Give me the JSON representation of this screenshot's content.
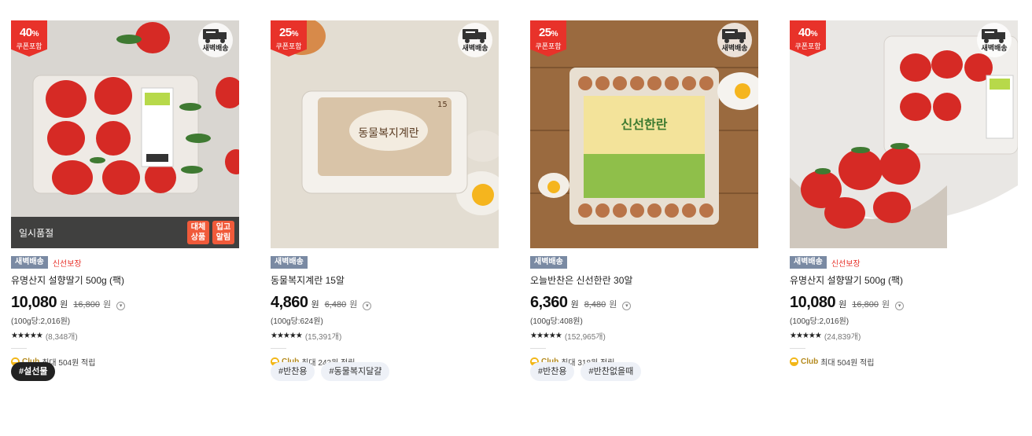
{
  "products": [
    {
      "discount": "40",
      "pct_sign": "%",
      "coupon": "쿠폰포함",
      "delivery_badge": "새벽배송",
      "soldout": {
        "label": "일시품절",
        "alt": "대체\n상품",
        "notify": "입고\n알림"
      },
      "tag_dawn": "새벽배송",
      "tag_fresh": "신선보장",
      "name": "유명산지 설향딸기 500g (팩)",
      "price": "10,080",
      "won": "원",
      "orig": "16,800",
      "orig_won": "원",
      "unit": "(100g당:2,016원)",
      "stars": "★★★★★",
      "reviews": "(8,348개)",
      "club_brand": "Club",
      "club_text": "최대 504원 적립",
      "tags": [
        "#설선물"
      ]
    },
    {
      "discount": "25",
      "pct_sign": "%",
      "coupon": "쿠폰포함",
      "delivery_badge": "새벽배송",
      "tag_dawn": "새벽배송",
      "tag_fresh": "",
      "name": "동물복지계란 15알",
      "price": "4,860",
      "won": "원",
      "orig": "6,480",
      "orig_won": "원",
      "unit": "(100g당:624원)",
      "stars": "★★★★★",
      "reviews": "(15,391개)",
      "club_brand": "Club",
      "club_text": "최대 243원 적립",
      "tags": [
        "#반찬용",
        "#동물복지달걀"
      ],
      "box_title": "동물복지계란",
      "box_count": "15"
    },
    {
      "discount": "25",
      "pct_sign": "%",
      "coupon": "쿠폰포함",
      "delivery_badge": "새벽배송",
      "tag_dawn": "새벽배송",
      "tag_fresh": "",
      "name": "오늘반찬은 신선한란 30알",
      "price": "6,360",
      "won": "원",
      "orig": "8,480",
      "orig_won": "원",
      "unit": "(100g당:408원)",
      "stars": "★★★★★",
      "reviews": "(152,965개)",
      "club_brand": "Club",
      "club_text": "최대 318원 적립",
      "tags": [
        "#반찬용",
        "#반찬없을때"
      ],
      "label_title": "신선한란"
    },
    {
      "discount": "40",
      "pct_sign": "%",
      "coupon": "쿠폰포함",
      "delivery_badge": "새벽배송",
      "tag_dawn": "새벽배송",
      "tag_fresh": "신선보장",
      "name": "유명산지 설향딸기 500g (팩)",
      "price": "10,080",
      "won": "원",
      "orig": "16,800",
      "orig_won": "원",
      "unit": "(100g당:2,016원)",
      "stars": "★★★★★",
      "reviews": "(24,839개)",
      "club_brand": "Club",
      "club_text": "최대 504원 적립",
      "tags": []
    }
  ],
  "colors": {
    "discount": "#e8322a",
    "dawn_badge": "#7a8aa3",
    "fresh": "#e8322a",
    "club": "#f2b617"
  },
  "icons": {
    "delivery": "truck-icon",
    "info": "info-icon",
    "club": "club-coin-icon"
  }
}
